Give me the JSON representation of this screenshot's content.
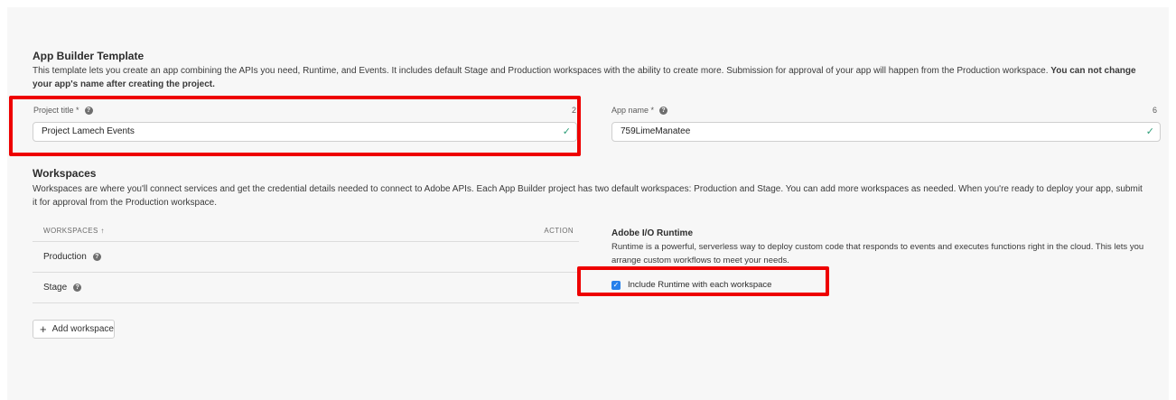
{
  "template": {
    "title": "App Builder Template",
    "desc_main": "This template lets you create an app combining the APIs you need, Runtime, and Events. It includes default Stage and Production workspaces with the ability to create more. Submission for approval of your app will happen from the Production workspace. ",
    "desc_bold": "You can not change your app's name after creating the project."
  },
  "project_title": {
    "label": "Project title *",
    "value": "Project Lamech Events",
    "counter": "2"
  },
  "app_name": {
    "label": "App name *",
    "value": "759LimeManatee",
    "counter": "6"
  },
  "workspaces": {
    "title": "Workspaces",
    "desc": "Workspaces are where you'll connect services and get the credential details needed to connect to Adobe APIs. Each App Builder project has two default workspaces: Production and Stage. You can add more workspaces as needed. When you're ready to deploy your app, submit it for approval from the Production workspace.",
    "col_name": "WORKSPACES ↑",
    "col_action": "ACTION",
    "rows": [
      {
        "name": "Production"
      },
      {
        "name": "Stage"
      }
    ],
    "add_label": "Add workspace"
  },
  "runtime": {
    "title": "Adobe I/O Runtime",
    "desc": "Runtime is a powerful, serverless way to deploy custom code that responds to events and executes functions right in the cloud. This lets you arrange custom workflows to meet your needs.",
    "checkbox_label": "Include Runtime with each workspace",
    "checked": true
  },
  "colors": {
    "highlight": "#ee0000",
    "checkbox": "#2680eb",
    "valid": "#2d9d78"
  }
}
